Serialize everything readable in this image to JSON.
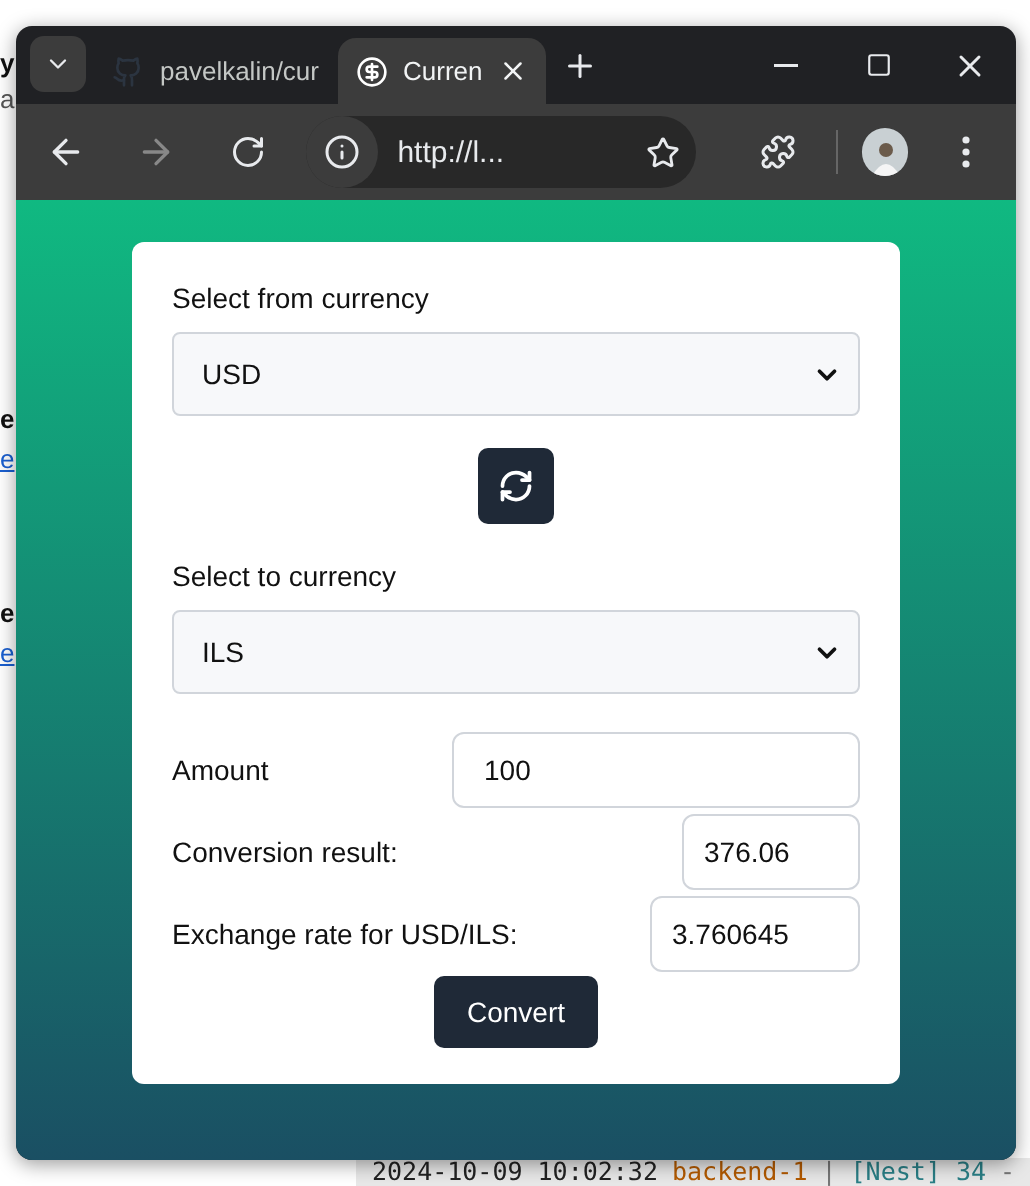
{
  "background": {
    "fragments": [
      {
        "text": "y",
        "kind": "heading"
      },
      {
        "text": "a",
        "kind": "plain"
      },
      {
        "text": "e",
        "kind": "heading"
      },
      {
        "text": "e",
        "kind": "link"
      },
      {
        "text": "e",
        "kind": "heading"
      },
      {
        "text": "e",
        "kind": "link"
      }
    ],
    "terminal": {
      "timestamp": "2024-10-09 10:02:32",
      "service": "backend-1",
      "separator": "|",
      "message": "[Nest] 34",
      "dash": "-"
    }
  },
  "browser": {
    "tabs": [
      {
        "title": "pavelkalin/cur",
        "selected": false
      },
      {
        "title": "Curren",
        "selected": true
      }
    ],
    "address": "http://l..."
  },
  "form": {
    "from": {
      "label": "Select from currency",
      "value": "USD"
    },
    "to": {
      "label": "Select to currency",
      "value": "ILS"
    },
    "rows": [
      {
        "label": "Amount",
        "value": "100",
        "kind": "input"
      },
      {
        "label": "Conversion result:",
        "value": "376.06",
        "kind": "output"
      },
      {
        "label": "Exchange rate for USD/ILS:",
        "value": "3.760645",
        "kind": "output"
      }
    ],
    "button": "Convert"
  }
}
